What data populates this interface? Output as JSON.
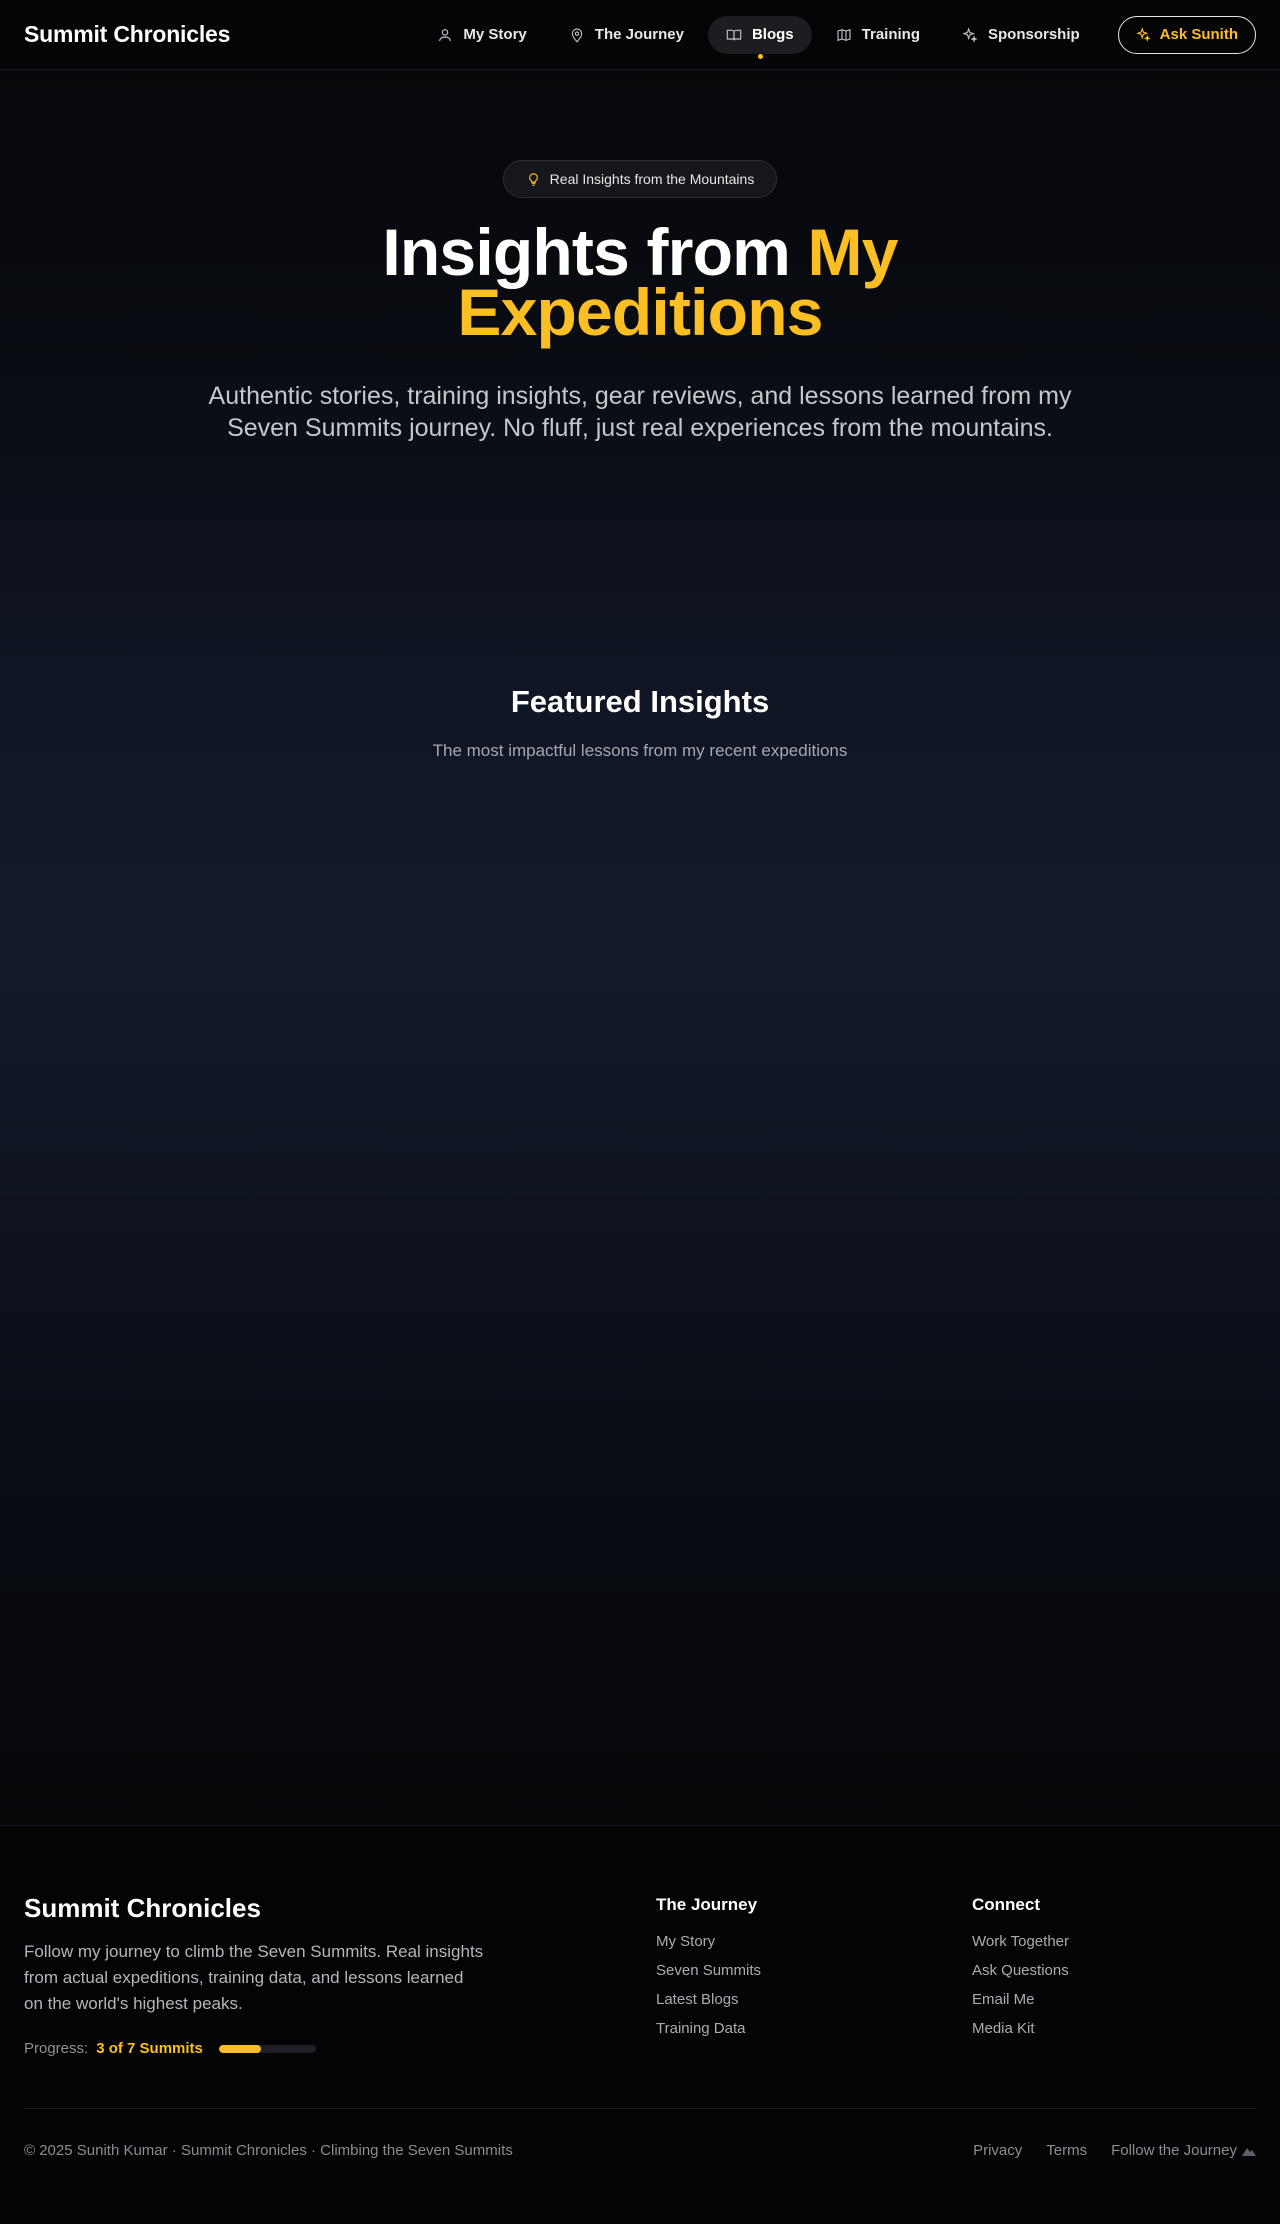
{
  "nav": {
    "brand": "Summit Chronicles",
    "items": [
      {
        "label": "My Story",
        "icon": "user-icon"
      },
      {
        "label": "The Journey",
        "icon": "map-pin-icon"
      },
      {
        "label": "Blogs",
        "icon": "book-open-icon",
        "active": true
      },
      {
        "label": "Training",
        "icon": "map-icon"
      },
      {
        "label": "Sponsorship",
        "icon": "sparkles-icon"
      }
    ],
    "cta": "Ask Sunith"
  },
  "hero": {
    "badge": "Real Insights from the Mountains",
    "title_plain": "Insights from ",
    "title_accent": "My Expeditions",
    "subtitle": "Authentic stories, training insights, gear reviews, and lessons learned from my Seven Summits journey. No fluff, just real experiences from the mountains."
  },
  "featured": {
    "title": "Featured Insights",
    "subtitle": "The most impactful lessons from my recent expeditions"
  },
  "footer": {
    "brand": "Summit Chronicles",
    "description": "Follow my journey to climb the Seven Summits. Real insights from actual expeditions, training data, and lessons learned on the world's highest peaks.",
    "progress_label": "Progress:",
    "progress_value": "3 of 7 Summits",
    "progress_fraction": 0.43,
    "journey": {
      "title": "The Journey",
      "links": [
        "My Story",
        "Seven Summits",
        "Latest Blogs",
        "Training Data"
      ]
    },
    "connect": {
      "title": "Connect",
      "links": [
        "Work Together",
        "Ask Questions",
        "Email Me",
        "Media Kit"
      ]
    },
    "copyright": "© 2025 Sunith Kumar · Summit Chronicles · Climbing the Seven Summits",
    "legal": [
      "Privacy",
      "Terms",
      "Follow the Journey"
    ]
  },
  "colors": {
    "accent": "#fbbf24",
    "background": "#050608"
  }
}
